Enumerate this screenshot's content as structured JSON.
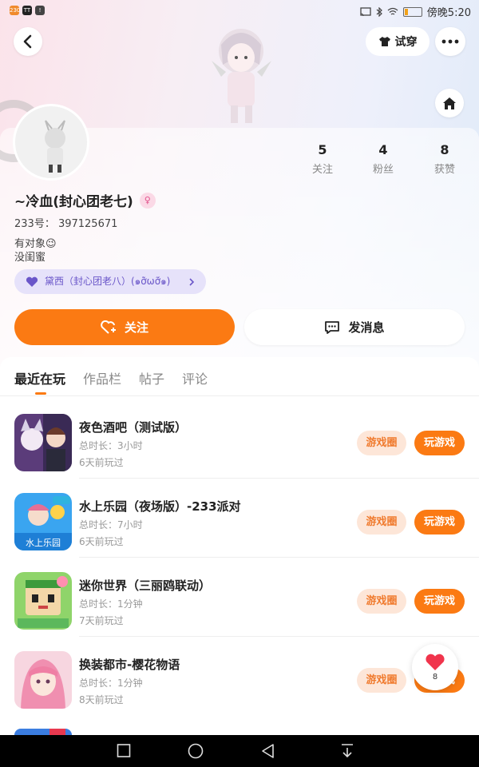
{
  "status_bar": {
    "time": "傍晚5:20",
    "app1": "230",
    "app2": "TT",
    "app3": "!"
  },
  "header": {
    "tryon_label": "试穿"
  },
  "profile": {
    "nickname": "~冷血(封心团老七)",
    "gender_symbol": "♀",
    "uid": "233号：  397125671",
    "bio_line1": "有对象😉",
    "bio_line2": "没闺蜜",
    "cp_label": "黛西（封心团老八）(๑ỡ̀ωỡ́๑)",
    "stats": [
      {
        "num": "5",
        "label": "关注"
      },
      {
        "num": "4",
        "label": "粉丝"
      },
      {
        "num": "8",
        "label": "获赞"
      }
    ],
    "follow_label": "关注",
    "message_label": "发消息"
  },
  "tabs": [
    "最近在玩",
    "作品栏",
    "帖子",
    "评论"
  ],
  "games": [
    {
      "title": "夜色酒吧（测试版）",
      "duration": "总时长：3小时",
      "last_played": "6天前玩过",
      "circle_label": "游戏圈",
      "play_label": "玩游戏"
    },
    {
      "title": "水上乐园（夜场版）-233派对",
      "duration": "总时长：7小时",
      "last_played": "6天前玩过",
      "circle_label": "游戏圈",
      "play_label": "玩游戏",
      "icon_text": "水上乐园"
    },
    {
      "title": "迷你世界（三丽鸥联动）",
      "duration": "总时长：1分钟",
      "last_played": "7天前玩过",
      "circle_label": "游戏圈",
      "play_label": "玩游戏"
    },
    {
      "title": "换装都市-樱花物语",
      "duration": "总时长：1分钟",
      "last_played": "8天前玩过",
      "circle_label": "游戏圈",
      "play_label": "玩游戏"
    }
  ],
  "like_count": "8",
  "colors": {
    "accent": "#fb7a13",
    "chip": "#e6e2fa",
    "circle_btn_bg": "#fde6d8"
  }
}
